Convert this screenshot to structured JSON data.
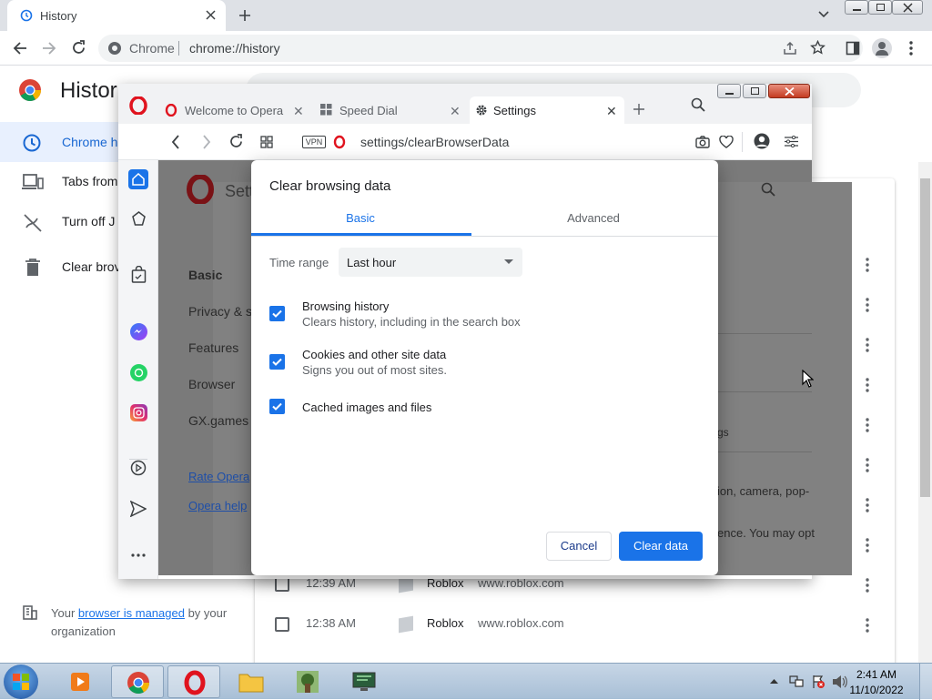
{
  "chrome": {
    "tab_title": "History",
    "omnibox_label": "Chrome",
    "omnibox_url": "chrome://history",
    "page_title": "Histor",
    "nav": [
      {
        "label": "Chrome h"
      },
      {
        "label": "Tabs from"
      },
      {
        "label": "Turn off J"
      },
      {
        "label": "Clear brov"
      }
    ],
    "managed_prefix": "Your ",
    "managed_link": "browser is managed",
    "managed_suffix": " by your organization",
    "rows": [
      {
        "time": "12:39 AM",
        "title": "Roblox",
        "domain": "www.roblox.com"
      },
      {
        "time": "12:38 AM",
        "title": "Roblox",
        "domain": "www.roblox.com"
      }
    ]
  },
  "opera": {
    "tabs": [
      {
        "title": "Welcome to Opera | M"
      },
      {
        "title": "Speed Dial"
      },
      {
        "title": "Settings"
      }
    ],
    "url_host": "settings",
    "url_path": "/clearBrowserData",
    "vpn_badge": "VPN",
    "settings_heading": "Sett",
    "menu": [
      "Basic",
      "Privacy & s",
      "Features",
      "Browser",
      "GX.games"
    ],
    "links": [
      "Rate Opera",
      "Opera help"
    ],
    "bg_snippets": [
      "gs",
      "ion, camera, pop-",
      "ence. You may opt"
    ]
  },
  "dialog": {
    "title": "Clear browsing data",
    "tab_basic": "Basic",
    "tab_advanced": "Advanced",
    "time_range_label": "Time range",
    "time_range_value": "Last hour",
    "options": [
      {
        "title": "Browsing history",
        "subtitle": "Clears history, including in the search box",
        "checked": true
      },
      {
        "title": "Cookies and other site data",
        "subtitle": "Signs you out of most sites.",
        "checked": true
      },
      {
        "title": "Cached images and files",
        "subtitle": "",
        "checked": true
      }
    ],
    "cancel_label": "Cancel",
    "clear_label": "Clear data",
    "accent_color": "#1a73e8"
  },
  "taskbar": {
    "time": "2:41 AM",
    "date": "11/10/2022"
  }
}
